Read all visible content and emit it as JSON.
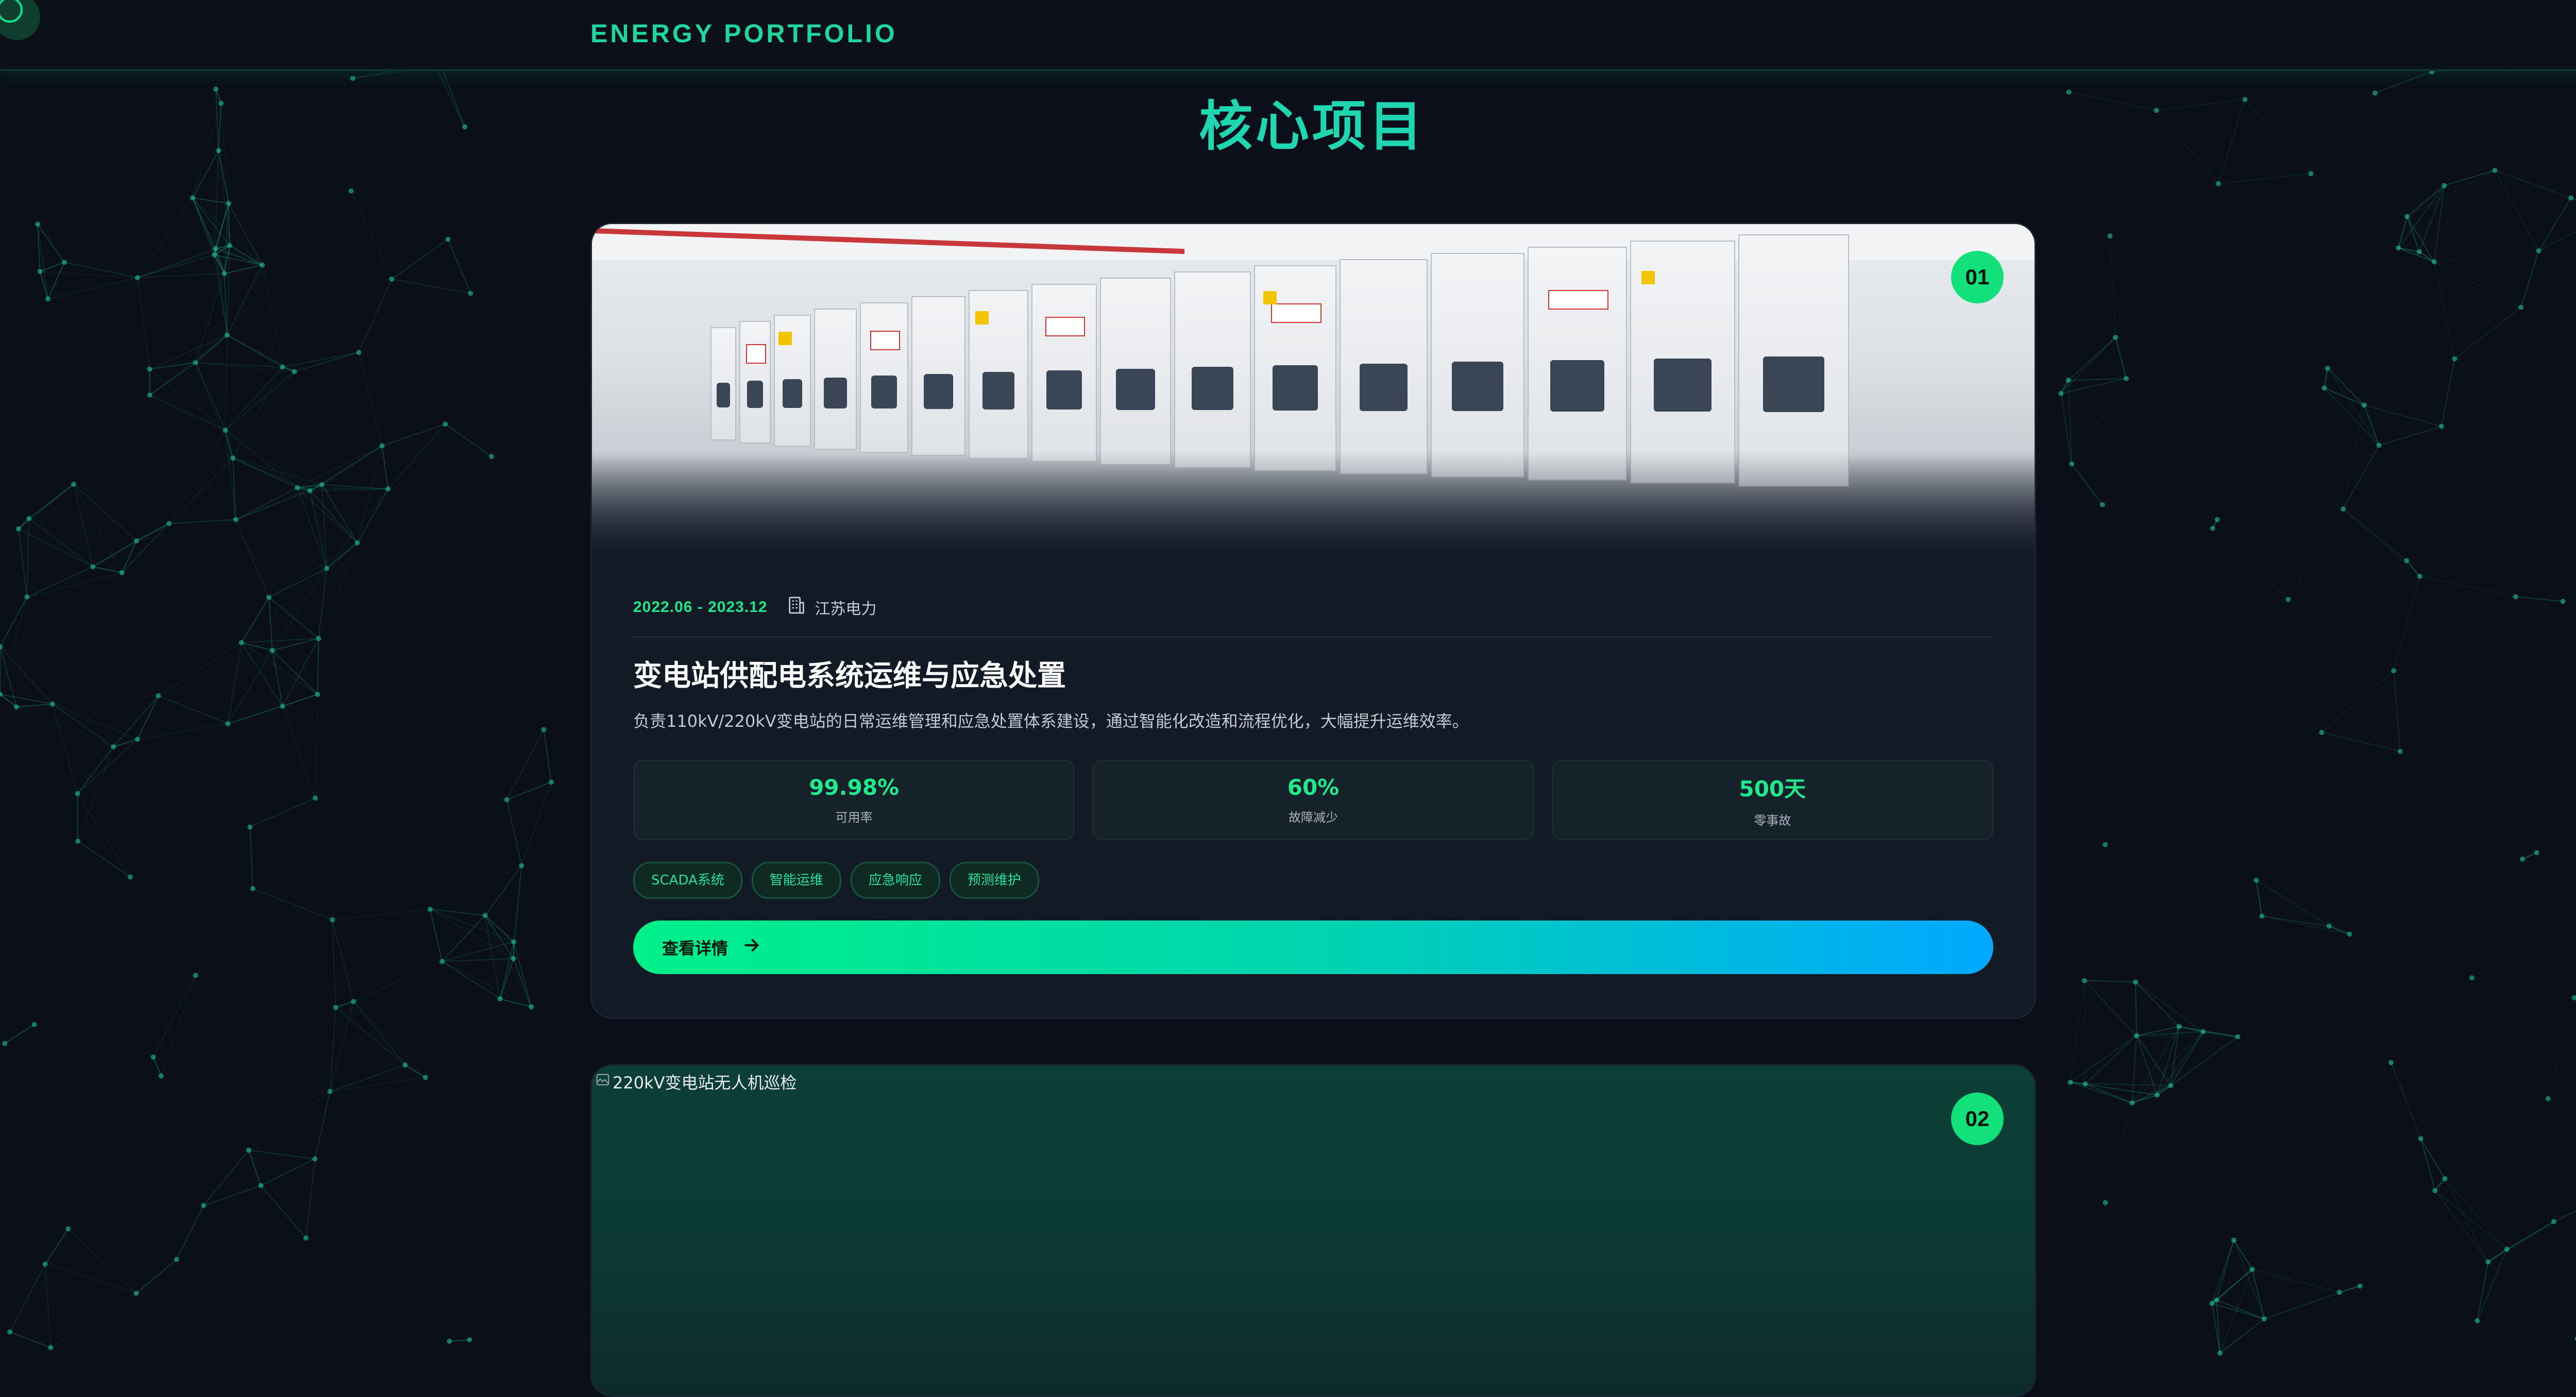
{
  "header": {
    "brand": "ENERGY PORTFOLIO"
  },
  "section": {
    "title": "核心项目"
  },
  "projects": [
    {
      "number": "01",
      "date": "2022.06 - 2023.12",
      "org": "江苏电力",
      "title": "变电站供配电系统运维与应急处置",
      "description": "负责110kV/220kV变电站的日常运维管理和应急处置体系建设，通过智能化改造和流程优化，大幅提升运维效率。",
      "stats": [
        {
          "value": "99.98%",
          "label": "可用率"
        },
        {
          "value": "60%",
          "label": "故障减少"
        },
        {
          "value": "500天",
          "label": "零事故"
        }
      ],
      "tags": [
        "SCADA系统",
        "智能运维",
        "应急响应",
        "预测维护"
      ],
      "cta": "查看详情"
    },
    {
      "number": "02",
      "image_alt": "220kV变电站无人机巡检"
    }
  ],
  "colors": {
    "accent": "#12e07a",
    "cyan": "#1fd6b0",
    "background": "#0a0f1a",
    "card": "#121a26"
  },
  "icons": {
    "org": "building-icon",
    "cta": "arrow-right-icon",
    "broken_image": "broken-image-icon"
  }
}
